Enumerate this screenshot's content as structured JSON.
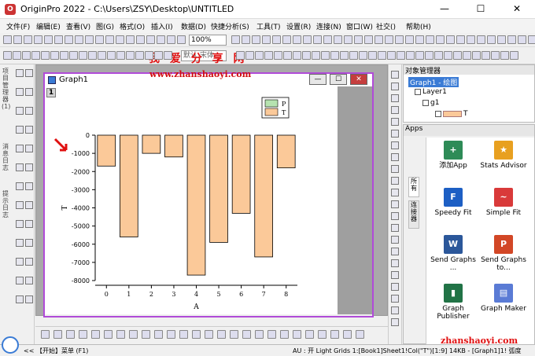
{
  "window": {
    "title": "OriginPro 2022 - C:\\Users\\ZSY\\Desktop\\UNTITLED",
    "minimize": "—",
    "maximize": "☐",
    "close": "✕"
  },
  "menu": [
    "文件(F)",
    "编辑(E)",
    "查看(V)",
    "图(G)",
    "格式(O)",
    "插入(I)",
    "数据(D)",
    "快捷分析(S)",
    "工具(T)",
    "设置(R)",
    "连接(N)",
    "窗口(W)",
    "社交()",
    "帮助(H)"
  ],
  "toolbar": {
    "zoom": "100%",
    "font": "默认:宋体"
  },
  "left_tabs": [
    "项目管理器(1)",
    "消息日志",
    "提示日志"
  ],
  "watermark": {
    "text": "我 爱 分 享 网",
    "url": "www.zhanshaoyi.com"
  },
  "graph_window": {
    "title": "Graph1",
    "layer_number": "1",
    "min": "—",
    "max": "☐",
    "close": "✕"
  },
  "object_manager": {
    "title": "对象管理器",
    "items": [
      "Graph1 - 绘图",
      "Layer1",
      "g1",
      "T"
    ]
  },
  "apps": {
    "title": "Apps",
    "tabs": [
      "所有",
      "连接器"
    ],
    "items": [
      {
        "label": "添加App",
        "icon": "plus-icon",
        "color": "#2e8b57"
      },
      {
        "label": "Stats Advisor",
        "icon": "wand-icon",
        "color": "#e8a020"
      },
      {
        "label": "Speedy Fit",
        "icon": "f-logo-icon",
        "color": "#1d5fc4"
      },
      {
        "label": "Simple Fit",
        "icon": "pdf-fit-icon",
        "color": "#d93a3a"
      },
      {
        "label": "Send Graphs ...",
        "icon": "word-icon",
        "color": "#2b579a"
      },
      {
        "label": "Send Graphs to...",
        "icon": "ppt-icon",
        "color": "#d24726"
      },
      {
        "label": "Graph Publisher",
        "icon": "publisher-icon",
        "color": "#217346"
      },
      {
        "label": "Graph Maker",
        "icon": "maker-icon",
        "color": "#5a7bd5"
      }
    ]
  },
  "statusbar": {
    "left": "<< 【开始】菜单 (F1)",
    "right": "AU : 开  Light Grids  1:[Book1]Sheet1!Col(\"T\")[1:9]  14KB - [Graph1]1! 弧度"
  },
  "status_watermark": "zhanshaoyi.com",
  "chart_data": {
    "type": "bar",
    "categories": [
      "0",
      "1",
      "2",
      "3",
      "4",
      "5",
      "6",
      "7",
      "8"
    ],
    "values": [
      -1700,
      -5600,
      -1000,
      -1200,
      -7700,
      -5900,
      -4300,
      -6700,
      -1800
    ],
    "xlabel": "A",
    "ylabel": "T",
    "ylim": [
      -8000,
      0
    ],
    "yticks": [
      0,
      -1000,
      -2000,
      -3000,
      -4000,
      -5000,
      -6000,
      -7000,
      -8000
    ],
    "legend": [
      "P",
      "T"
    ],
    "legend_position": "top-right",
    "bar_color": "#fbc999",
    "legend_p_color": "#b6e3b0",
    "grid": false
  }
}
